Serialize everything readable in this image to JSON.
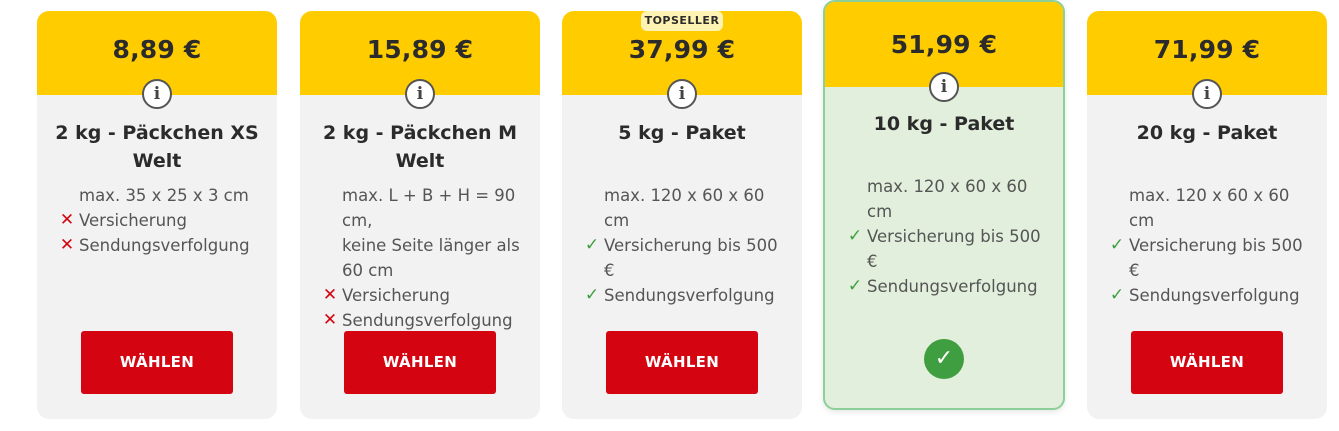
{
  "cards": [
    {
      "price": "8,89 €",
      "title_line1": "2 kg - Päckchen XS",
      "title_line2": "Welt",
      "dim_lines": [
        "max. 35 x 25 x 3 cm"
      ],
      "features": [
        {
          "label": "Versicherung",
          "included": false
        },
        {
          "label": "Sendungsverfolgung",
          "included": false
        }
      ],
      "button": "WÄHLEN"
    },
    {
      "price": "15,89 €",
      "title_line1": "2 kg - Päckchen M",
      "title_line2": "Welt",
      "dim_lines": [
        "max. L + B + H = 90 cm,",
        "keine Seite länger als",
        "60 cm"
      ],
      "features": [
        {
          "label": "Versicherung",
          "included": false
        },
        {
          "label": "Sendungsverfolgung",
          "included": false
        }
      ],
      "button": "WÄHLEN"
    },
    {
      "badge": "TOPSELLER",
      "price": "37,99 €",
      "title_line1": "5 kg - Paket",
      "title_line2": "",
      "dim_lines": [
        "max. 120 x 60 x 60 cm"
      ],
      "features": [
        {
          "label": "Versicherung bis 500 €",
          "included": true
        },
        {
          "label": "Sendungsverfolgung",
          "included": true
        }
      ],
      "button": "WÄHLEN"
    },
    {
      "price": "51,99 €",
      "title_line1": "10 kg - Paket",
      "title_line2": "",
      "dim_lines": [
        "max. 120 x 60 x 60 cm"
      ],
      "features": [
        {
          "label": "Versicherung bis 500 €",
          "included": true
        },
        {
          "label": "Sendungsverfolgung",
          "included": true
        }
      ],
      "selected": true
    },
    {
      "price": "71,99 €",
      "title_line1": "20 kg - Paket",
      "title_line2": "",
      "dim_lines": [
        "max. 120 x 60 x 60 cm"
      ],
      "features": [
        {
          "label": "Versicherung bis 500 €",
          "included": true
        },
        {
          "label": "Sendungsverfolgung",
          "included": true
        }
      ],
      "button": "WÄHLEN"
    }
  ],
  "icons": {
    "info": "info-icon",
    "included": "checkmark-icon",
    "excluded": "cross-icon",
    "selected": "selected-check-icon"
  },
  "colors": {
    "price_band": "#ffcc00",
    "button": "#d40511",
    "selected_bg": "#e1efdc",
    "check": "#3f9e3f",
    "cross": "#d40511"
  }
}
